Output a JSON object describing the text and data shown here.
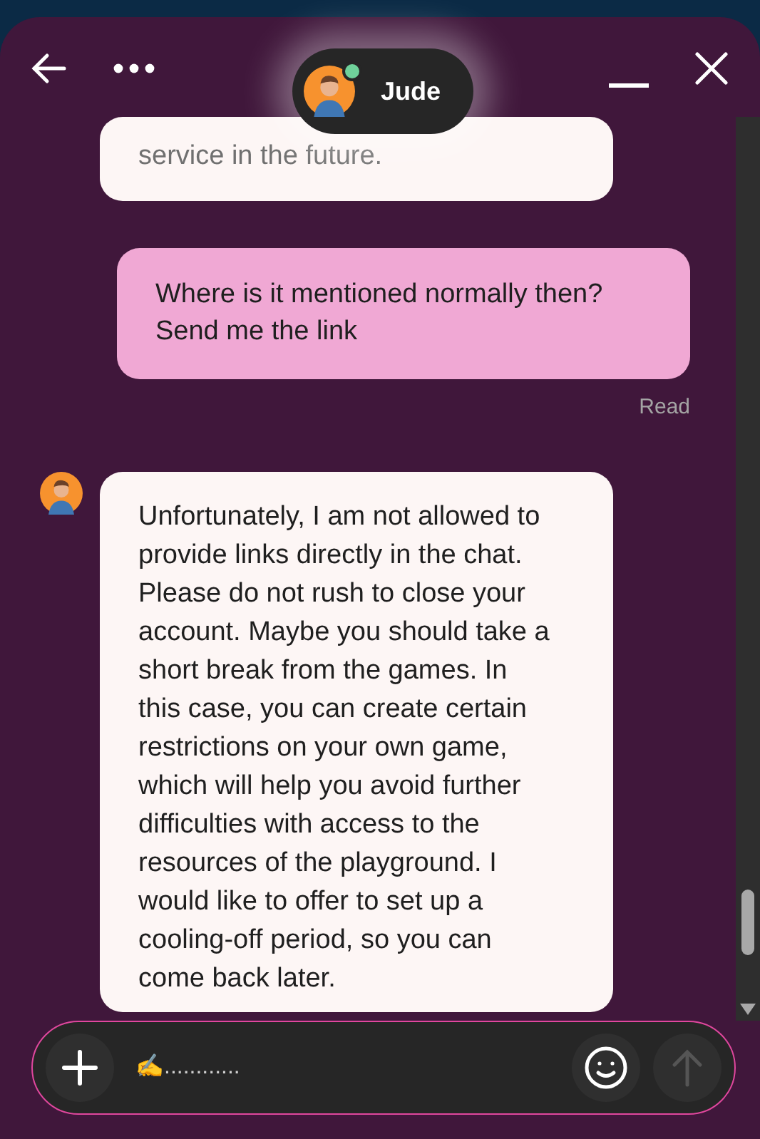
{
  "header": {
    "contact": {
      "name": "Jude",
      "online": true
    }
  },
  "messages": [
    {
      "kind": "received",
      "show_avatar": false,
      "text": "service in the future."
    },
    {
      "kind": "sent",
      "text": "Where is it mentioned normally then? Send me the link",
      "status": "Read"
    },
    {
      "kind": "received",
      "show_avatar": true,
      "text": "Unfortunately, I am not allowed to provide links directly in the chat.\nPlease do not rush to close your account. Maybe you should take a short break from the games. In this case, you can create certain restrictions on your own game, which will help you avoid further difficulties with access to the resources of the playground. I would like to offer to set up a cooling-off period, so you can come back later."
    }
  ],
  "composer": {
    "placeholder": "✍............",
    "send_disabled": true
  }
}
